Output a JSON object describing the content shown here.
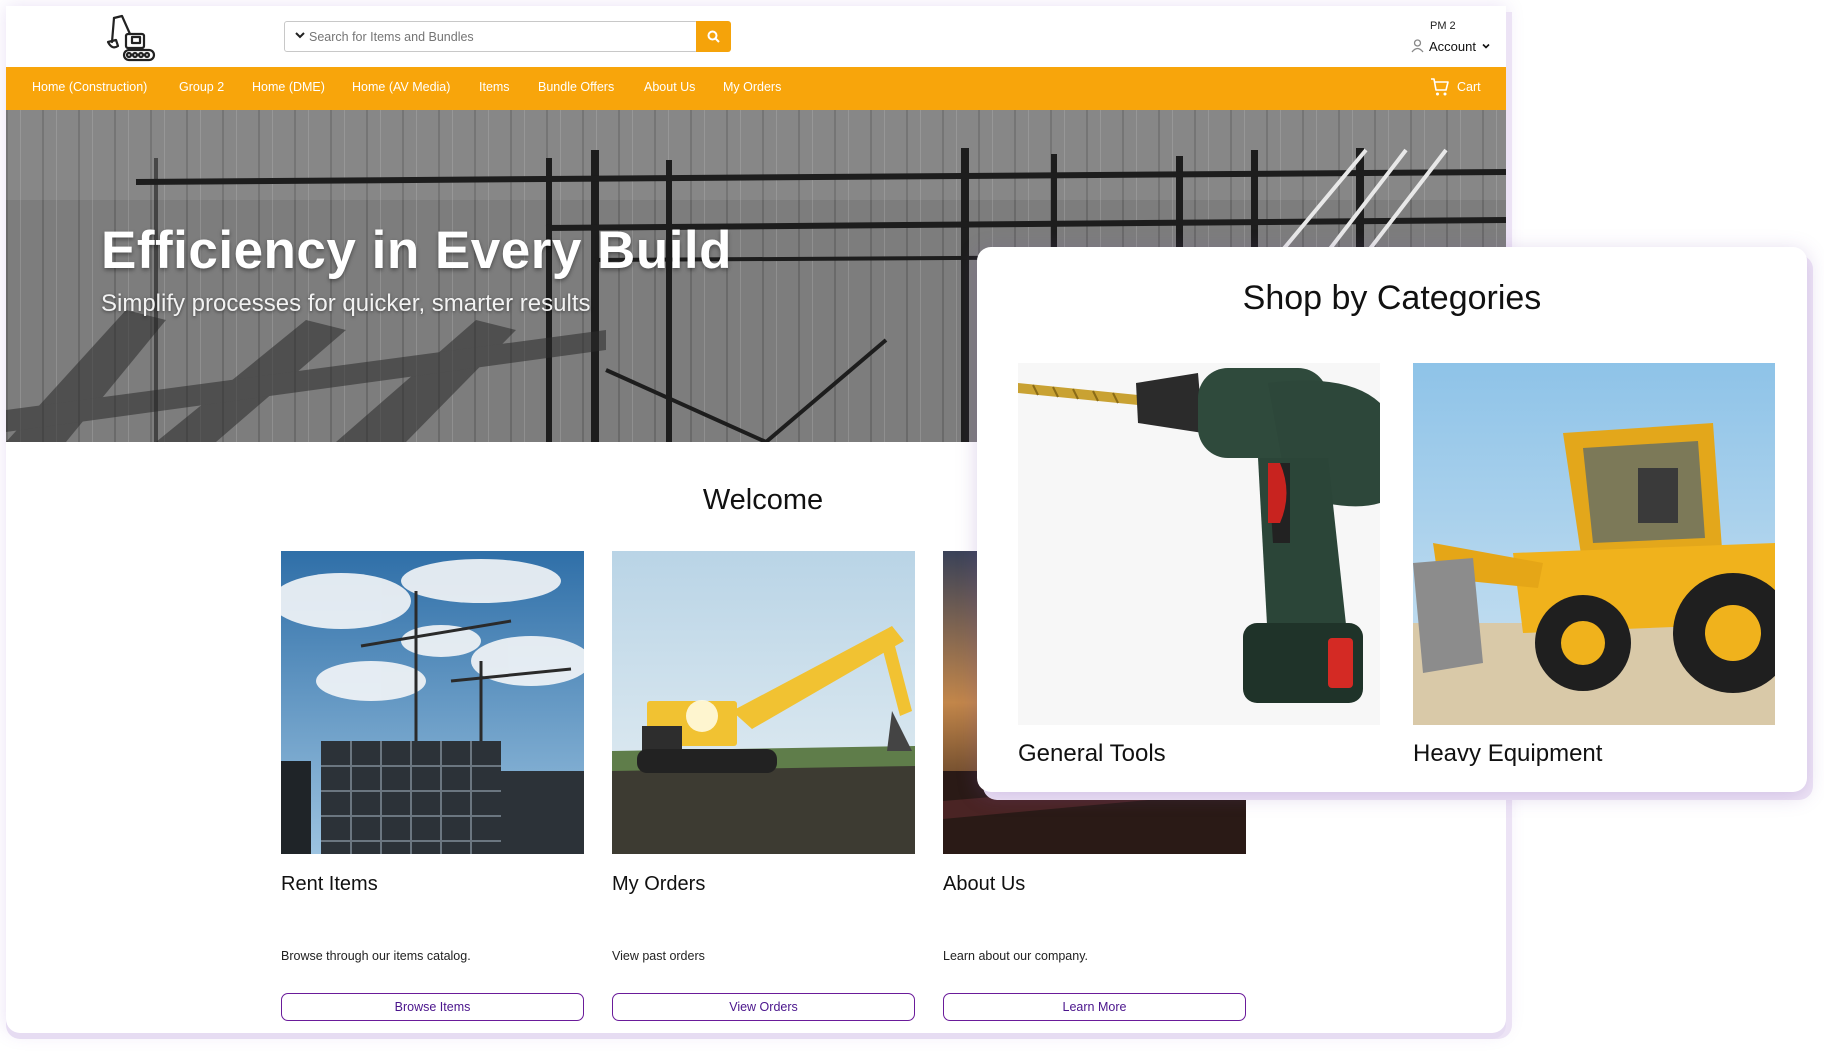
{
  "header": {
    "search_placeholder": "Search for Items and Bundles",
    "account_user": "PM 2",
    "account_label": "Account",
    "brand_color": "#f8a50b"
  },
  "nav": {
    "items": [
      "Home (Construction)",
      "Group 2",
      "Home (DME)",
      "Home (AV Media)",
      "Items",
      "Bundle Offers",
      "About Us",
      "My Orders"
    ],
    "cart_label": "Cart"
  },
  "hero": {
    "title": "Efficiency in Every Build",
    "subtitle": "Simplify processes for quicker, smarter results"
  },
  "welcome": {
    "heading": "Welcome",
    "cards": [
      {
        "title": "Rent Items",
        "description": "Browse through our items catalog.",
        "button": "Browse Items"
      },
      {
        "title": "My Orders",
        "description": "View past orders",
        "button": "View Orders"
      },
      {
        "title": "About Us",
        "description": "Learn about our company.",
        "button": "Learn More"
      }
    ]
  },
  "categories": {
    "heading": "Shop by Categories",
    "items": [
      {
        "label": "General Tools"
      },
      {
        "label": "Heavy Equipment"
      }
    ]
  },
  "icons": [
    "excavator-logo-icon",
    "chevron-down-icon",
    "search-icon",
    "user-icon",
    "cart-icon"
  ],
  "colors": {
    "accent": "#f8a50b",
    "button_border": "#6a1b9a"
  }
}
